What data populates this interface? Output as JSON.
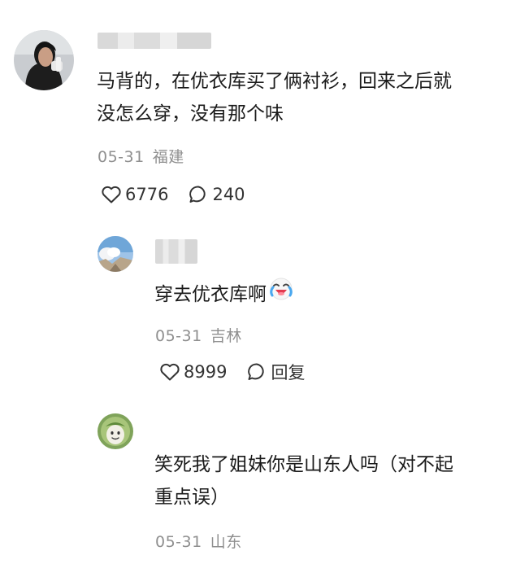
{
  "comments": [
    {
      "text_lines": [
        "马背的，在优衣库买了俩衬衫，回来之后就",
        "没怎么穿，没有那个味"
      ],
      "date": "05-31",
      "location": "福建",
      "likes": "6776",
      "reply_count": "240",
      "avatar_icon": "woman-portrait-avatar"
    },
    {
      "text": "穿去优衣库啊",
      "emoji_icon": "crying-laughing-emoji",
      "date": "05-31",
      "location": "吉林",
      "likes": "8999",
      "reply_label": "回复",
      "avatar_icon": "sky-landscape-avatar"
    },
    {
      "text_lines": [
        "笑死我了姐妹你是山东人吗（对不起",
        "重点误）"
      ],
      "date": "05-31",
      "location": "山东",
      "avatar_icon": "green-cartoon-avatar"
    }
  ],
  "colors": {
    "text": "#1a1a1a",
    "meta": "#8f8f8f",
    "icon": "#333333"
  }
}
